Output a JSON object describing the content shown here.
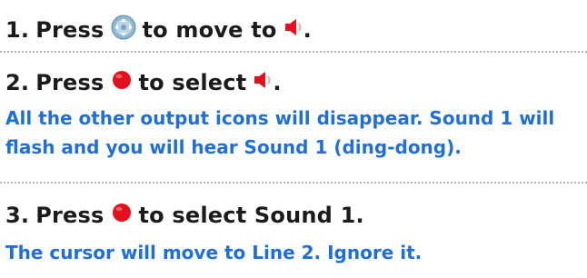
{
  "steps": [
    {
      "number": "1.",
      "text_before": "Press",
      "button_icon": "directional-pad-icon",
      "text_after": "to move to",
      "target_icon": "speaker-icon",
      "trail": "."
    },
    {
      "number": "2.",
      "text_before": "Press",
      "button_icon": "red-button-icon",
      "text_after": "to select",
      "target_icon": "speaker-icon",
      "trail": ".",
      "note_lines": [
        "All the other output icons will disappear. Sound 1 will",
        "flash and you will hear Sound 1 (ding-dong)."
      ]
    },
    {
      "number": "3.",
      "text_before": "Press",
      "button_icon": "red-button-icon",
      "text_after": "to select Sound 1.",
      "note_lines": [
        "The cursor will move to Line 2. Ignore it."
      ]
    }
  ],
  "colors": {
    "note_text": "#1f6fd6",
    "step_text": "#1b1b1b",
    "red_button": "#e5101e",
    "speaker_red": "#e5101e",
    "dpad": "#8fb6cf",
    "divider": "#b8b8b8"
  }
}
